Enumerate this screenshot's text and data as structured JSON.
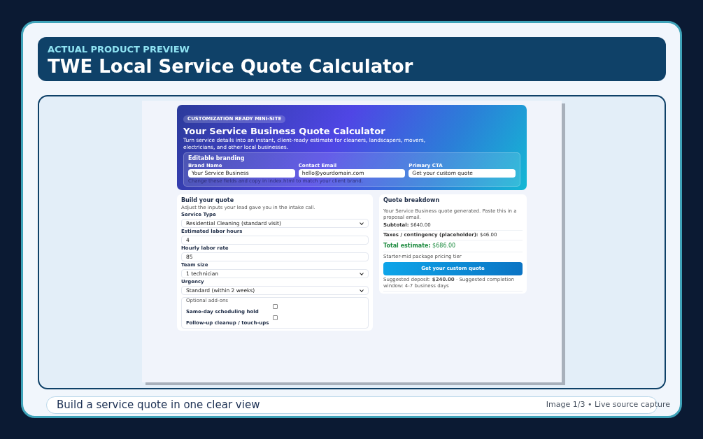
{
  "header": {
    "eyebrow": "ACTUAL PRODUCT PREVIEW",
    "title": "TWE Local Service Quote Calculator"
  },
  "hero": {
    "badge": "CUSTOMIZATION READY MINI-SITE",
    "title": "Your Service Business Quote Calculator",
    "description": "Turn service details into an instant, client-ready estimate for cleaners, landscapers, movers, electricians, and other local businesses.",
    "branding": {
      "title": "Editable branding",
      "fields": [
        {
          "label": "Brand Name",
          "value": "Your Service Business"
        },
        {
          "label": "Contact Email",
          "value": "hello@yourdomain.com"
        },
        {
          "label": "Primary CTA",
          "value": "Get your custom quote"
        }
      ],
      "hint": "Change these fields and copy in index.html to match your client brand."
    }
  },
  "builder": {
    "title": "Build your quote",
    "intro": "Adjust the inputs your lead gave you in the intake call.",
    "fields": [
      {
        "kind": "select",
        "label": "Service Type",
        "value": "Residential Cleaning (standard visit)"
      },
      {
        "kind": "input",
        "label": "Estimated labor hours",
        "value": "4"
      },
      {
        "kind": "input",
        "label": "Hourly labor rate",
        "value": "85"
      },
      {
        "kind": "select",
        "label": "Team size",
        "value": "1 technician"
      },
      {
        "kind": "select",
        "label": "Urgency",
        "value": "Standard (within 2 weeks)"
      }
    ],
    "addons": {
      "legend": "Optional add-ons",
      "items": [
        {
          "label": "Same-day scheduling hold",
          "checked": false
        },
        {
          "label": "Follow-up cleanup / touch-ups",
          "checked": false
        }
      ]
    }
  },
  "breakdown": {
    "title": "Quote breakdown",
    "message": "Your Service Business quote generated. Paste this in a proposal email.",
    "lines": [
      {
        "text": "**Subtotal:** $640.00"
      },
      {
        "text": "**Taxes / contingency (placeholder):** $46.00"
      }
    ],
    "total": "**Total estimate:** $686.00",
    "tier": "Starter-mid package pricing tier",
    "button": "Get your custom quote",
    "footnote": "Suggested deposit: **$240.00** · Suggested completion window: 4-7 business days"
  },
  "caption": {
    "text": "Build a service quote in one clear view",
    "counter": "Image 1/3 • Live source capture"
  }
}
